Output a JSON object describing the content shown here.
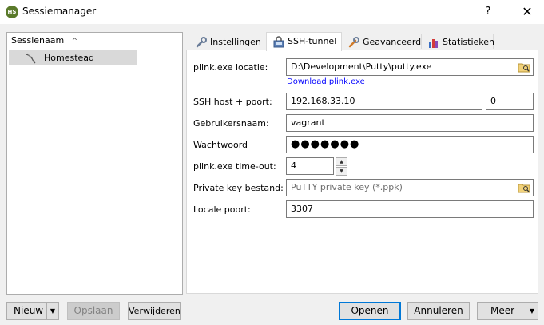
{
  "window": {
    "title": "Sessiemanager",
    "app_icon_text": "HS",
    "help_label": "?",
    "close_label": "✕"
  },
  "tree": {
    "column_header": "Sessienaam",
    "sort_indicator": "^",
    "items": [
      {
        "label": "Homestead",
        "icon": "dolphin-icon",
        "selected": true
      }
    ]
  },
  "tabs": [
    {
      "label": "Instellingen",
      "icon": "wrench-icon",
      "active": false
    },
    {
      "label": "SSH-tunnel",
      "icon": "lock-icon",
      "active": true
    },
    {
      "label": "Geavanceerd",
      "icon": "tools-icon",
      "active": false
    },
    {
      "label": "Statistieken",
      "icon": "bar-chart-icon",
      "active": false
    }
  ],
  "ssh": {
    "plink_location_label": "plink.exe locatie:",
    "plink_location_value": "D:\\Development\\Putty\\putty.exe",
    "download_link": "Download plink.exe",
    "host_port_label": "SSH host + poort:",
    "host_value": "192.168.33.10",
    "port_value": "0",
    "username_label": "Gebruikersnaam:",
    "username_value": "vagrant",
    "password_label": "Wachtwoord",
    "password_mask": "●●●●●●●",
    "timeout_label": "plink.exe time-out:",
    "timeout_value": "4",
    "private_key_label": "Private key bestand:",
    "private_key_placeholder": "PuTTY private key (*.ppk)",
    "local_port_label": "Locale poort:",
    "local_port_value": "3307"
  },
  "buttons": {
    "new": "Nieuw",
    "save": "Opslaan",
    "delete": "Verwijderen",
    "open": "Openen",
    "cancel": "Annuleren",
    "more": "Meer"
  },
  "colors": {
    "accent": "#0078d7",
    "selection": "#d9d9d9",
    "link": "#0000ff"
  }
}
